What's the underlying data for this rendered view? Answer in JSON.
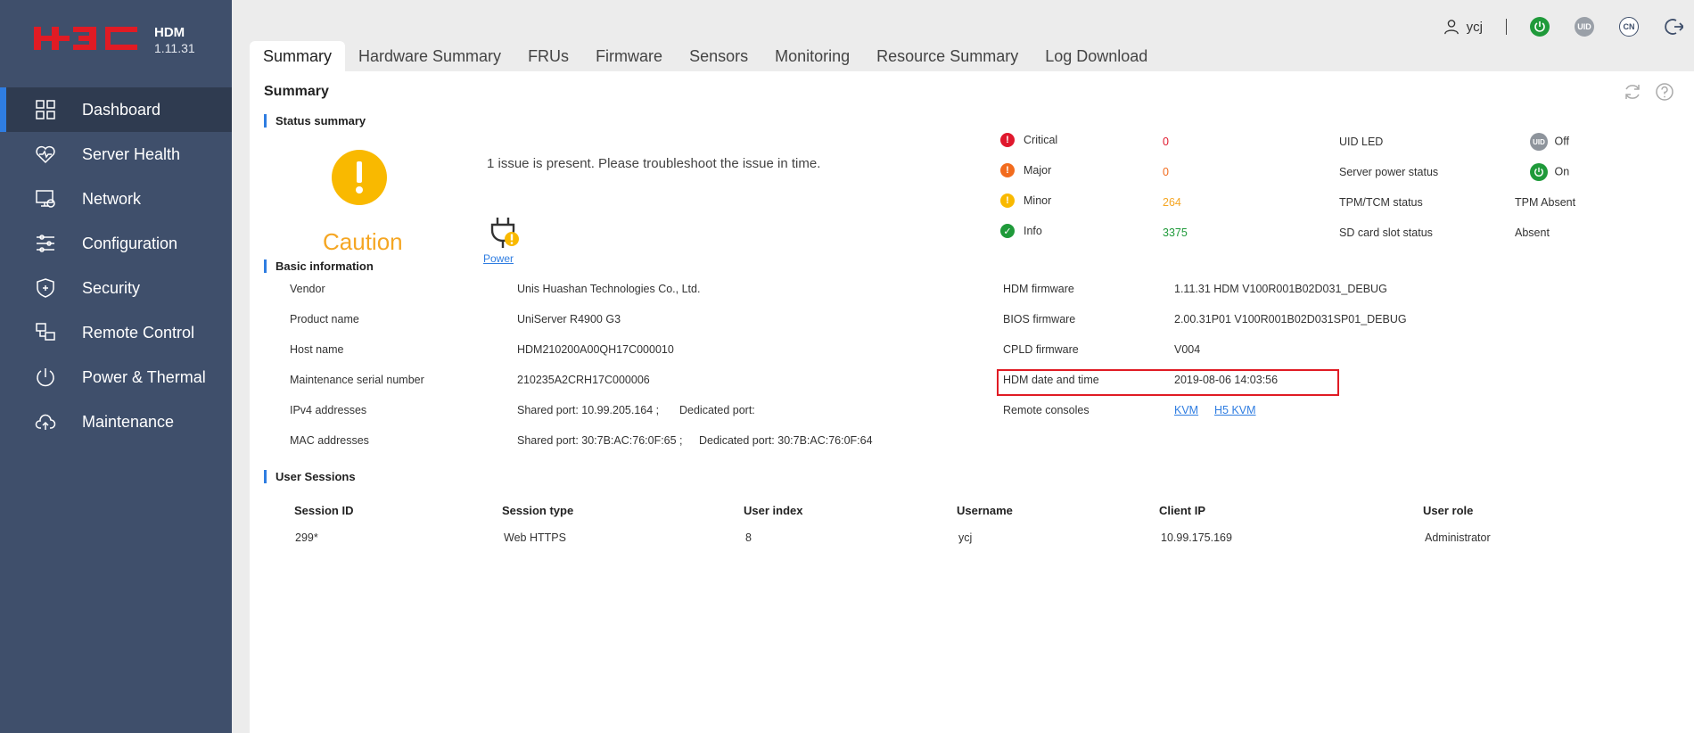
{
  "app": {
    "logo_text": "H3C",
    "name": "HDM",
    "version": "1.11.31"
  },
  "sidebar": {
    "items": [
      {
        "label": "Dashboard",
        "icon": "dashboard-icon",
        "active": true
      },
      {
        "label": "Server Health",
        "icon": "heart-icon"
      },
      {
        "label": "Network",
        "icon": "network-icon"
      },
      {
        "label": "Configuration",
        "icon": "sliders-icon"
      },
      {
        "label": "Security",
        "icon": "shield-icon"
      },
      {
        "label": "Remote Control",
        "icon": "remote-icon"
      },
      {
        "label": "Power & Thermal",
        "icon": "power-icon"
      },
      {
        "label": "Maintenance",
        "icon": "cloud-upload-icon"
      }
    ]
  },
  "topbar": {
    "user": "ycj",
    "uid_label": "UID",
    "lang_label": "CN"
  },
  "tabs": [
    "Summary",
    "Hardware Summary",
    "FRUs",
    "Firmware",
    "Sensors",
    "Monitoring",
    "Resource Summary",
    "Log Download"
  ],
  "summary": {
    "title": "Summary",
    "status_title": "Status summary",
    "caution_label": "Caution",
    "issue_text": "1 issue is present. Please troubleshoot the issue in time.",
    "component_link": "Power",
    "counts": [
      {
        "label": "Critical",
        "value": "0",
        "color": "#e0182d",
        "mark": "!"
      },
      {
        "label": "Major",
        "value": "0",
        "color": "#f26b1d",
        "mark": "!"
      },
      {
        "label": "Minor",
        "value": "264",
        "color": "#f9b900",
        "mark": "!"
      },
      {
        "label": "Info",
        "value": "3375",
        "color": "#1f9a3a",
        "mark": "✓"
      }
    ],
    "status": {
      "uid_led_label": "UID LED",
      "uid_led_value": "Off",
      "power_label": "Server power status",
      "power_value": "On",
      "tpm_label": "TPM/TCM status",
      "tpm_value": "TPM Absent",
      "sd_label": "SD card slot status",
      "sd_value": "Absent"
    }
  },
  "basic": {
    "title": "Basic information",
    "vendor_label": "Vendor",
    "vendor": "Unis Huashan Technologies Co., Ltd.",
    "product_label": "Product name",
    "product": "UniServer R4900 G3",
    "host_label": "Host name",
    "host": "HDM210200A00QH17C000010",
    "serial_label": "Maintenance serial number",
    "serial": "210235A2CRH17C000006",
    "ipv4_label": "IPv4 addresses",
    "ipv4_shared": "Shared port: 10.99.205.164 ;",
    "ipv4_dedicated": "Dedicated port:",
    "mac_label": "MAC addresses",
    "mac_shared": "Shared port: 30:7B:AC:76:0F:65 ;",
    "mac_dedicated": "Dedicated port: 30:7B:AC:76:0F:64",
    "hdm_fw_label": "HDM firmware",
    "hdm_fw": "1.11.31 HDM V100R001B02D031_DEBUG",
    "bios_label": "BIOS firmware",
    "bios": "2.00.31P01 V100R001B02D031SP01_DEBUG",
    "cpld_label": "CPLD firmware",
    "cpld": "V004",
    "datetime_label": "HDM date and time",
    "datetime": "2019-08-06 14:03:56",
    "consoles_label": "Remote consoles",
    "kvm": "KVM",
    "h5kvm": "H5 KVM"
  },
  "sessions": {
    "title": "User Sessions",
    "headers": [
      "Session ID",
      "Session type",
      "User index",
      "Username",
      "Client IP",
      "User role"
    ],
    "rows": [
      [
        "299*",
        "Web HTTPS",
        "8",
        "ycj",
        "10.99.175.169",
        "Administrator"
      ]
    ]
  },
  "colors": {
    "accent": "#2f7de1",
    "sidebar": "#3f4f6b",
    "caution": "#f9b900",
    "highlight": "#e01b24"
  }
}
